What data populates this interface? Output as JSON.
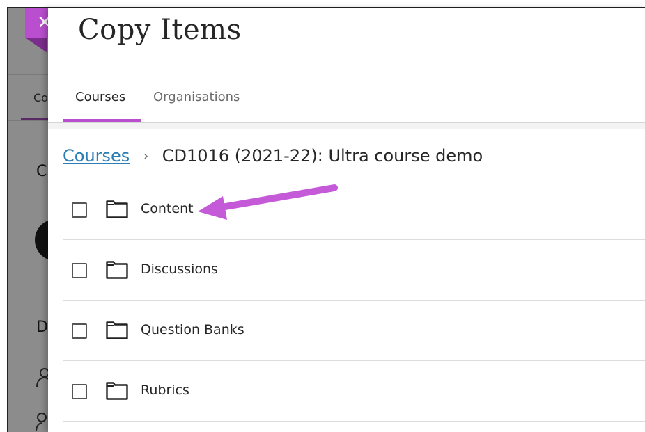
{
  "background": {
    "tab_label": "Co",
    "letter_c": "C",
    "letter_d": "D"
  },
  "close_button": {
    "label": "✕"
  },
  "panel": {
    "title": "Copy Items",
    "tabs": [
      {
        "label": "Courses",
        "selected": true
      },
      {
        "label": "Organisations",
        "selected": false
      }
    ],
    "breadcrumb": {
      "root": "Courses",
      "separator": "›",
      "current": "CD1016 (2021-22): Ultra course demo"
    },
    "items": [
      {
        "label": "Content",
        "checked": false
      },
      {
        "label": "Discussions",
        "checked": false
      },
      {
        "label": "Question Banks",
        "checked": false
      },
      {
        "label": "Rubrics",
        "checked": false
      }
    ]
  },
  "colors": {
    "accent": "#b94fcf",
    "link": "#2a7db5",
    "annotation_arrow": "#c45ad8"
  }
}
